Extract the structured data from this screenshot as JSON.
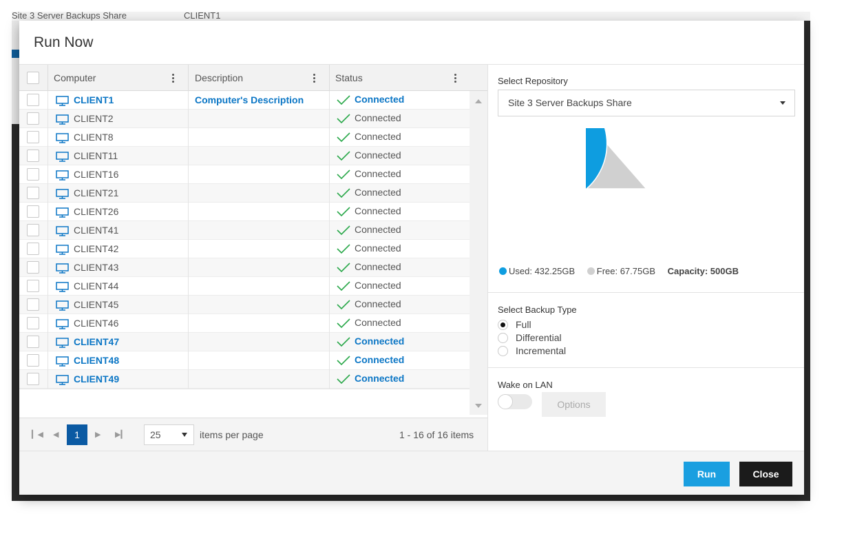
{
  "background": {
    "strip_text": "Site 3 Server Backups Share",
    "strip_text2": "CLIENT1"
  },
  "dialog": {
    "title": "Run Now"
  },
  "grid": {
    "columns": [
      "Computer",
      "Description",
      "Status"
    ],
    "rows": [
      {
        "computer": "CLIENT1",
        "description": "Computer's Description",
        "status": "Connected",
        "selected": true
      },
      {
        "computer": "CLIENT2",
        "description": "",
        "status": "Connected",
        "selected": false
      },
      {
        "computer": "CLIENT8",
        "description": "",
        "status": "Connected",
        "selected": false
      },
      {
        "computer": "CLIENT11",
        "description": "",
        "status": "Connected",
        "selected": false
      },
      {
        "computer": "CLIENT16",
        "description": "",
        "status": "Connected",
        "selected": false
      },
      {
        "computer": "CLIENT21",
        "description": "",
        "status": "Connected",
        "selected": false
      },
      {
        "computer": "CLIENT26",
        "description": "",
        "status": "Connected",
        "selected": false
      },
      {
        "computer": "CLIENT41",
        "description": "",
        "status": "Connected",
        "selected": false
      },
      {
        "computer": "CLIENT42",
        "description": "",
        "status": "Connected",
        "selected": false
      },
      {
        "computer": "CLIENT43",
        "description": "",
        "status": "Connected",
        "selected": false
      },
      {
        "computer": "CLIENT44",
        "description": "",
        "status": "Connected",
        "selected": false
      },
      {
        "computer": "CLIENT45",
        "description": "",
        "status": "Connected",
        "selected": false
      },
      {
        "computer": "CLIENT46",
        "description": "",
        "status": "Connected",
        "selected": false
      },
      {
        "computer": "CLIENT47",
        "description": "",
        "status": "Connected",
        "selected": true
      },
      {
        "computer": "CLIENT48",
        "description": "",
        "status": "Connected",
        "selected": true
      },
      {
        "computer": "CLIENT49",
        "description": "",
        "status": "Connected",
        "selected": true
      }
    ]
  },
  "pager": {
    "first_icon": "first-page-icon",
    "prev_icon": "prev-page-icon",
    "next_icon": "next-page-icon",
    "last_icon": "last-page-icon",
    "current_page": "1",
    "page_size": "25",
    "page_size_label": "items per page",
    "info": "1 - 16 of 16 items"
  },
  "repository": {
    "label": "Select Repository",
    "selected": "Site 3 Server Backups Share",
    "used_label": "Used: 432.25GB",
    "free_label": "Free: 67.75GB",
    "capacity_label": "Capacity: 500GB",
    "used_gb": 432.25,
    "free_gb": 67.75,
    "used_color": "#0e9de0",
    "free_color": "#d0d0d0"
  },
  "backup_type": {
    "label": "Select Backup Type",
    "options": [
      "Full",
      "Differential",
      "Incremental"
    ],
    "selected": "Full"
  },
  "wake_on_lan": {
    "label": "Wake on LAN",
    "enabled": false,
    "options_label": "Options"
  },
  "footer": {
    "run_label": "Run",
    "close_label": "Close"
  },
  "colors": {
    "accent": "#0b76c5",
    "check": "#2aa84a",
    "pager_active": "#0b5aa3",
    "run_button": "#1a9fe0",
    "close_button": "#1b1b1b"
  }
}
